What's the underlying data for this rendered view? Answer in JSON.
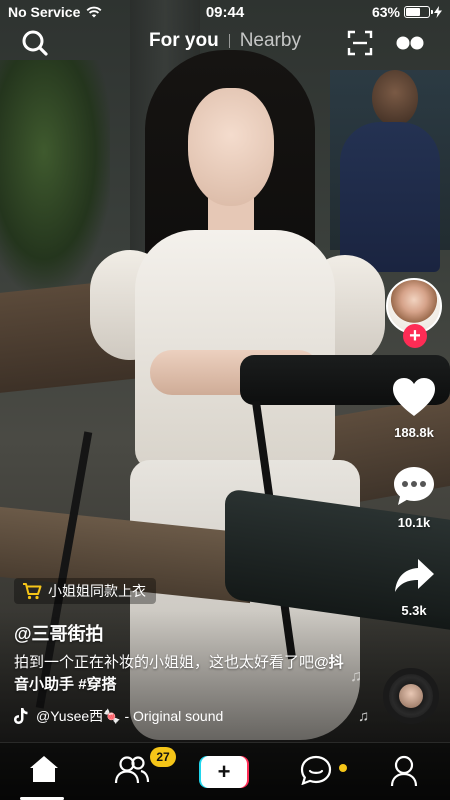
{
  "status_bar": {
    "carrier": "No Service",
    "time": "09:44",
    "battery_percent": "63%",
    "battery_level": 0.63
  },
  "top_nav": {
    "tab_active": "For you",
    "tab_inactive": "Nearby"
  },
  "rail": {
    "likes": "188.8k",
    "comments": "10.1k",
    "shares": "5.3k"
  },
  "video": {
    "shop_tag": "小姐姐同款上衣",
    "username": "@三哥街拍",
    "caption_text": "拍到一个正在补妆的小姐姐，这也太好看了吧",
    "caption_mention": "@抖音小助手",
    "caption_hashtag": "#穿搭",
    "sound": "@Yusee西🍬 - Original sound"
  },
  "bottom_nav": {
    "friends_badge": "27",
    "create_label": "+"
  },
  "colors": {
    "accent_red": "#fe2c55",
    "accent_cyan": "#20d5ec",
    "badge_yellow": "#f5c518"
  },
  "icons": [
    "search-icon",
    "scan-icon",
    "more-icon",
    "heart-icon",
    "comment-icon",
    "share-icon",
    "cart-icon",
    "tiktok-icon",
    "music-note-icon",
    "home-icon",
    "friends-icon",
    "create-icon",
    "inbox-icon",
    "profile-icon"
  ]
}
